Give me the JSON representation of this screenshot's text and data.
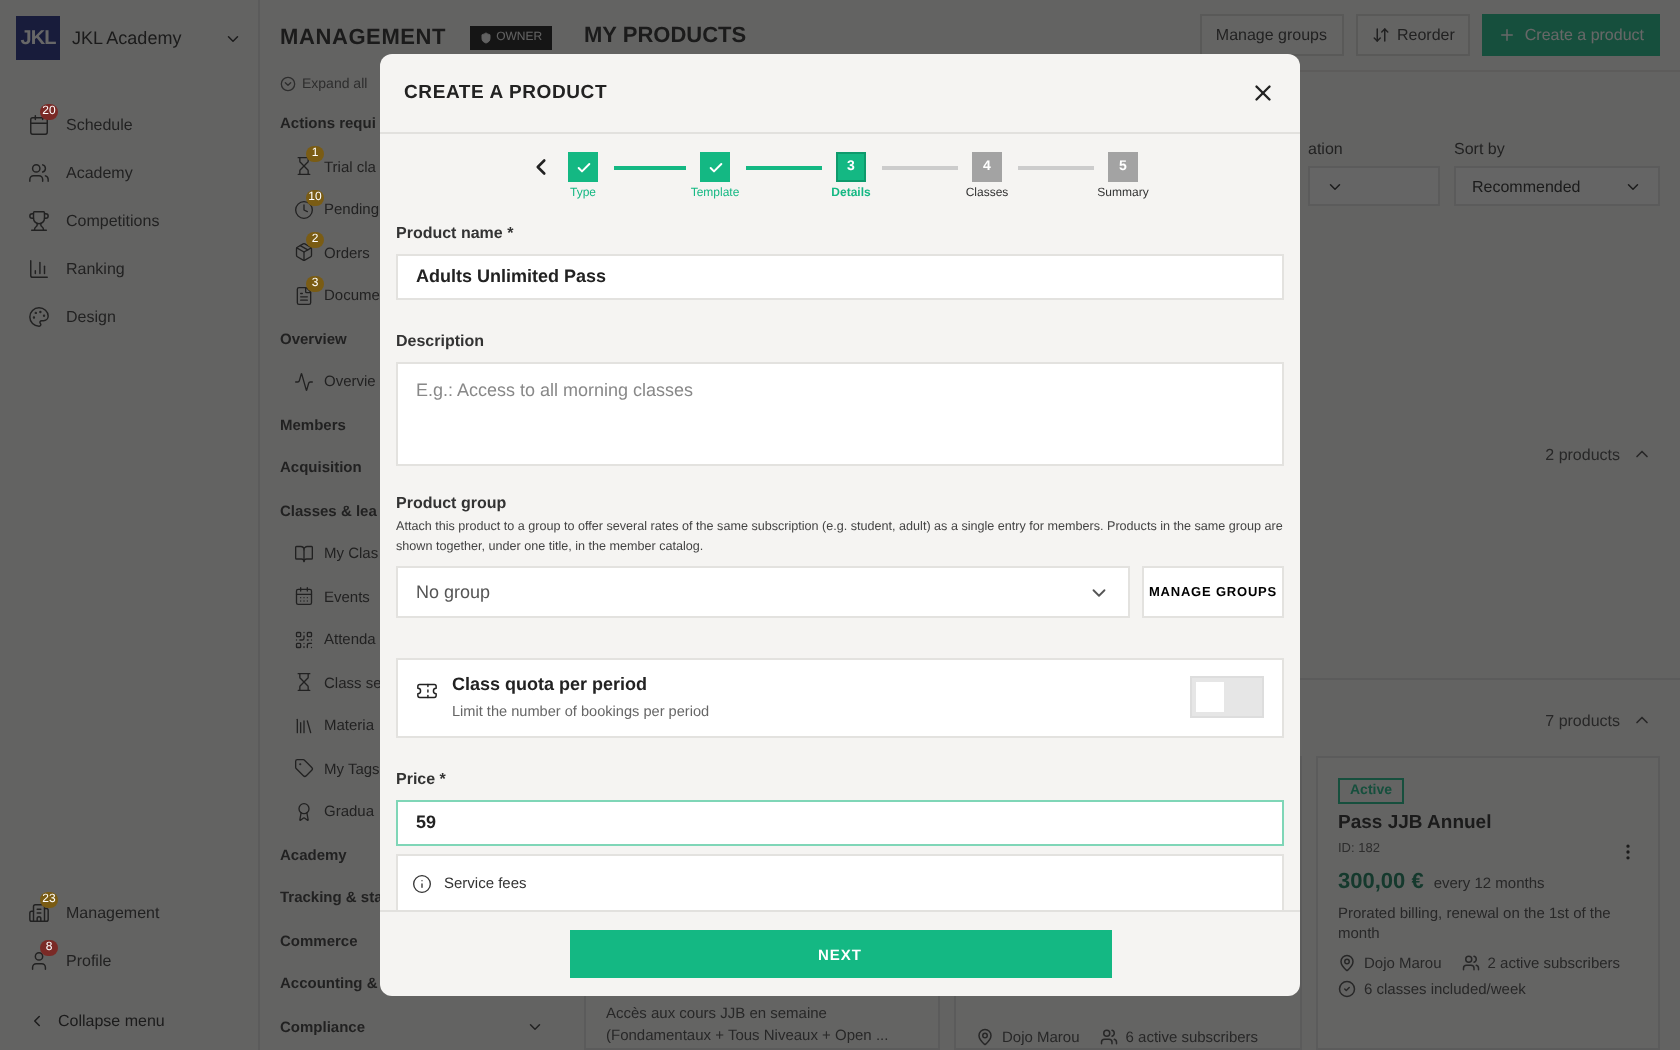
{
  "app": {
    "logo": "JKL",
    "name": "JKL Academy"
  },
  "nav": {
    "items": [
      {
        "label": "Schedule",
        "badge": "20",
        "color": "#7a2a26"
      },
      {
        "label": "Academy"
      },
      {
        "label": "Competitions"
      },
      {
        "label": "Ranking"
      },
      {
        "label": "Design"
      }
    ],
    "bottom_items": [
      {
        "label": "Management",
        "badge": "23",
        "color": "#7a5c14"
      },
      {
        "label": "Profile",
        "badge": "8",
        "color": "#7a2a26"
      }
    ],
    "collapse": "Collapse menu"
  },
  "management": {
    "title": "MANAGEMENT",
    "role": "OWNER",
    "expand": "Expand all",
    "sections": [
      {
        "label": "Actions requi",
        "children": [
          {
            "label": "Trial cla",
            "badge": "1",
            "color": "#7a5c14"
          },
          {
            "label": "Pending",
            "badge": "10",
            "color": "#7a5c14"
          },
          {
            "label": "Orders",
            "badge": "2",
            "color": "#7a5c14"
          },
          {
            "label": "Docume",
            "badge": "3",
            "color": "#7a5c14"
          }
        ]
      },
      {
        "label": "Overview",
        "children": [
          {
            "label": "Overvie"
          }
        ]
      },
      {
        "label": "Members"
      },
      {
        "label": "Acquisition"
      },
      {
        "label": "Classes & lea",
        "children": [
          {
            "label": "My Clas"
          },
          {
            "label": "Events"
          },
          {
            "label": "Attenda"
          },
          {
            "label": "Class se"
          },
          {
            "label": "Materia"
          },
          {
            "label": "My Tags"
          },
          {
            "label": "Gradua"
          }
        ]
      },
      {
        "label": "Academy"
      },
      {
        "label": "Tracking & sta"
      },
      {
        "label": "Commerce"
      },
      {
        "label": "Accounting &"
      },
      {
        "label": "Compliance",
        "expanded": false
      }
    ]
  },
  "products": {
    "title": "MY PRODUCTS",
    "actions": [
      {
        "label": "Manage groups",
        "primary": false
      },
      {
        "label": "Reorder",
        "primary": false
      },
      {
        "label": "Create a product",
        "primary": true
      }
    ],
    "filters": [
      {
        "label": "ation"
      },
      {
        "label": "Sort by",
        "value": "Recommended"
      }
    ],
    "groups": [
      {
        "count": "2 products",
        "expanded": true
      },
      {
        "count": "7 products",
        "expanded": true
      }
    ],
    "cards": [
      {
        "description": "Accès aux cours JJB en semaine (Fondamentaux + Tous Niveaux + Open ..."
      },
      {
        "location": "Dojo Marou",
        "subscribers": "6 active subscribers"
      },
      {
        "status": "Active",
        "name": "Pass JJB Annuel",
        "id": "ID: 182",
        "price": "300,00 €",
        "period": "every 12 months",
        "billing": "Prorated billing, renewal on the 1st of the month",
        "location": "Dojo Marou",
        "subscribers": "2 active subscribers",
        "classes": "6 classes included/week"
      }
    ]
  },
  "modal": {
    "title": "CREATE A PRODUCT",
    "steps": [
      {
        "label": "Type",
        "completed": true,
        "selected": false
      },
      {
        "label": "Template",
        "completed": true,
        "selected": false
      },
      {
        "label": "Details",
        "number": "3",
        "completed": false,
        "selected": true
      },
      {
        "label": "Classes",
        "number": "4",
        "completed": false,
        "selected": false
      },
      {
        "label": "Summary",
        "number": "5",
        "completed": false,
        "selected": false
      }
    ],
    "name": {
      "label": "Product name *",
      "value": "Adults Unlimited Pass"
    },
    "description": {
      "label": "Description",
      "placeholder": "E.g.: Access to all morning classes"
    },
    "group": {
      "label": "Product group",
      "help": "Attach this product to a group to offer several rates of the same subscription (e.g. student, adult) as a single entry for members. Products in the same group are shown together, under one title, in the member catalog.",
      "value": "No group",
      "button": "MANAGE GROUPS"
    },
    "quota": {
      "title": "Class quota per period",
      "subtitle": "Limit the number of bookings per period",
      "on": false
    },
    "price": {
      "label": "Price *",
      "value": "59",
      "focused": true
    },
    "fees": {
      "label": "Service fees"
    },
    "next": "NEXT"
  }
}
